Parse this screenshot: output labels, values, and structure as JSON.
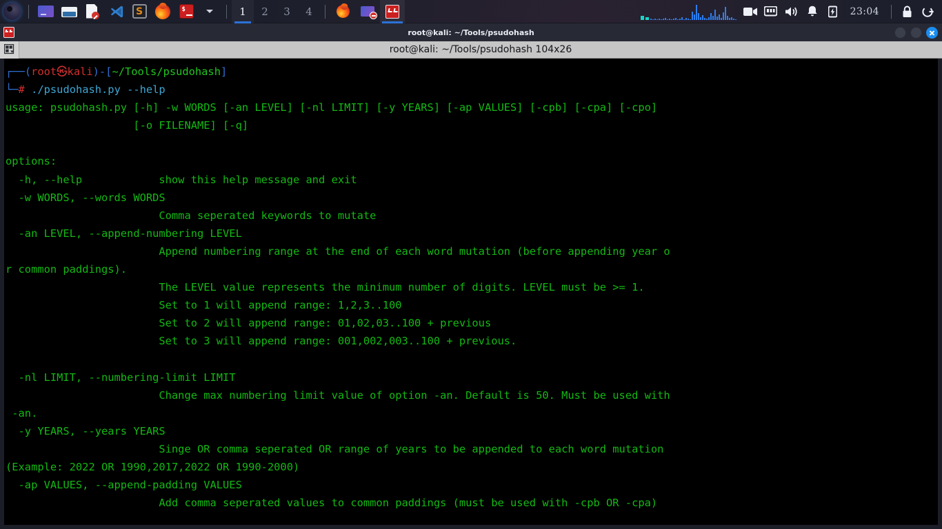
{
  "panel": {
    "launchers": [
      {
        "name": "kali-menu-icon",
        "label": "Kali Menu"
      },
      {
        "name": "file-manager-icon",
        "label": "File Manager"
      },
      {
        "name": "folder-icon",
        "label": "Folders"
      },
      {
        "name": "text-editor-icon",
        "label": "Text Editor"
      },
      {
        "name": "vscode-icon",
        "label": "Visual Studio Code"
      },
      {
        "name": "sublime-icon",
        "label": "S"
      },
      {
        "name": "firefox-icon",
        "label": "Firefox"
      },
      {
        "name": "terminal-icon",
        "label": "Terminal"
      },
      {
        "name": "chevron-down-icon",
        "label": "More"
      }
    ],
    "workspaces": [
      {
        "label": "1",
        "active": true
      },
      {
        "label": "2",
        "active": false
      },
      {
        "label": "3",
        "active": false
      },
      {
        "label": "4",
        "active": false
      }
    ],
    "window_buttons": [
      {
        "name": "taskbar-firefox",
        "label": "Firefox",
        "active": false
      },
      {
        "name": "taskbar-file-manager",
        "label": "Files",
        "active": false
      },
      {
        "name": "taskbar-terminal",
        "label": "root@kali: ~/Tools/psudohash",
        "active": true
      }
    ],
    "tray": [
      {
        "name": "network-graph",
        "label": "Network activity"
      },
      {
        "name": "camera-icon",
        "label": "Screen recorder"
      },
      {
        "name": "display-icon",
        "label": "Displays"
      },
      {
        "name": "volume-icon",
        "label": "Volume"
      },
      {
        "name": "bell-icon",
        "label": "Notifications"
      },
      {
        "name": "battery-icon",
        "label": "Power"
      }
    ],
    "clock": "23:04",
    "session": [
      {
        "name": "lock-icon",
        "label": "Lock screen"
      },
      {
        "name": "power-icon",
        "label": "Log out"
      }
    ],
    "accent_color": "#2b72d8",
    "background_color": "#1c1f2b"
  },
  "window": {
    "title": "root@kali: ~/Tools/psudohash",
    "buttons": {
      "minimize": "Minimize",
      "maximize": "Maximize",
      "close": "Close"
    },
    "tab": {
      "title": "root@kali: ~/Tools/psudohash 104x26",
      "menu_icon": "tab-layout-icon"
    }
  },
  "terminal": {
    "background_color": "#000000",
    "foreground_color": "#21c521",
    "prompt": {
      "frame_top": "┌──",
      "frame_bottom": "└─",
      "user_host": "root㉿kali",
      "path": "~/Tools/psudohash",
      "symbol": "#",
      "command": "./psudohash.py --help"
    },
    "output_lines": [
      "usage: psudohash.py [-h] -w WORDS [-an LEVEL] [-nl LIMIT] [-y YEARS] [-ap VALUES] [-cpb] [-cpa] [-cpo]",
      "                    [-o FILENAME] [-q]",
      "",
      "options:",
      "  -h, --help            show this help message and exit",
      "  -w WORDS, --words WORDS",
      "                        Comma seperated keywords to mutate",
      "  -an LEVEL, --append-numbering LEVEL",
      "                        Append numbering range at the end of each word mutation (before appending year or common paddings).",
      "                        The LEVEL value represents the minimum number of digits. LEVEL must be >= 1.",
      "                        Set to 1 will append range: 1,2,3..100",
      "                        Set to 2 will append range: 01,02,03..100 + previous",
      "                        Set to 3 will append range: 001,002,003..100 + previous.",
      "",
      "  -nl LIMIT, --numbering-limit LIMIT",
      "                        Change max numbering limit value of option -an. Default is 50. Must be used with -an.",
      "  -y YEARS, --years YEARS",
      "                        Singe OR comma seperated OR range of years to be appended to each word mutation (Example: 2022 OR 1990,2017,2022 OR 1990-2000)",
      "  -ap VALUES, --append-padding VALUES",
      "                        Add comma seperated values to common paddings (must be used with -cpb OR -cpa)"
    ]
  }
}
